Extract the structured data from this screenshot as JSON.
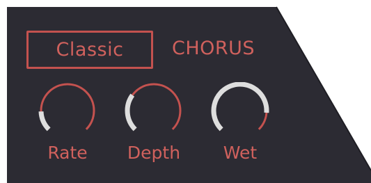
{
  "preset": {
    "label": "Classic"
  },
  "effect": {
    "title": "CHORUS"
  },
  "knobs": [
    {
      "id": "rate",
      "label": "Rate",
      "value": 0.0
    },
    {
      "id": "depth",
      "label": "Depth",
      "value": 0.3
    },
    {
      "id": "wet",
      "label": "Wet",
      "value": 0.85
    }
  ],
  "colors": {
    "panel": "#2c2b33",
    "accent": "#c4524f",
    "text_accent": "#d0615d",
    "knob_value": "#dedede"
  }
}
